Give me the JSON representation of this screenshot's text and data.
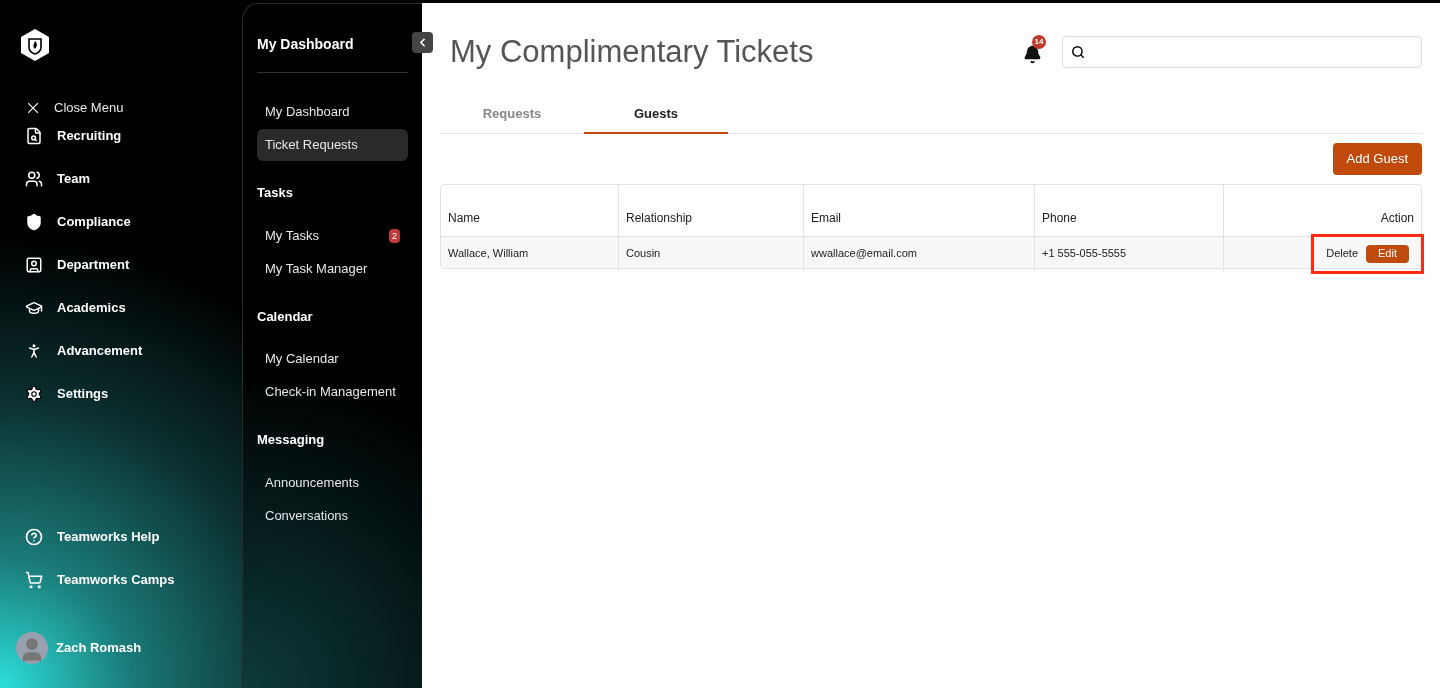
{
  "sidebar": {
    "close_label": "Close Menu",
    "items": [
      {
        "label": "Recruiting"
      },
      {
        "label": "Team"
      },
      {
        "label": "Compliance"
      },
      {
        "label": "Department"
      },
      {
        "label": "Academics"
      },
      {
        "label": "Advancement"
      },
      {
        "label": "Settings"
      }
    ],
    "footer_items": [
      {
        "label": "Teamworks Help"
      },
      {
        "label": "Teamworks Camps"
      }
    ],
    "user": {
      "name": "Zach Romash"
    }
  },
  "subnav": {
    "title": "My Dashboard",
    "sections": [
      {
        "items": [
          {
            "label": "My Dashboard",
            "selected": false
          },
          {
            "label": "Ticket Requests",
            "selected": true
          }
        ]
      },
      {
        "heading": "Tasks",
        "items": [
          {
            "label": "My Tasks",
            "selected": false,
            "badge": "2"
          },
          {
            "label": "My Task Manager",
            "selected": false
          }
        ]
      },
      {
        "heading": "Calendar",
        "items": [
          {
            "label": "My Calendar",
            "selected": false
          },
          {
            "label": "Check-in Management",
            "selected": false
          }
        ]
      },
      {
        "heading": "Messaging",
        "items": [
          {
            "label": "Announcements",
            "selected": false
          },
          {
            "label": "Conversations",
            "selected": false
          }
        ]
      }
    ]
  },
  "page": {
    "title": "My Complimentary Tickets",
    "notifications": "14",
    "tabs": [
      {
        "label": "Requests",
        "selected": false
      },
      {
        "label": "Guests",
        "selected": true
      }
    ],
    "add_button": "Add Guest",
    "table": {
      "columns": [
        "Name",
        "Relationship",
        "Email",
        "Phone",
        "Action"
      ],
      "rows": [
        {
          "cells": [
            "Wallace, William",
            "Cousin",
            "wwallace@email.com",
            "+1 555-055-5555"
          ],
          "delete": "Delete",
          "edit": "Edit",
          "highlighted": true
        }
      ]
    }
  }
}
